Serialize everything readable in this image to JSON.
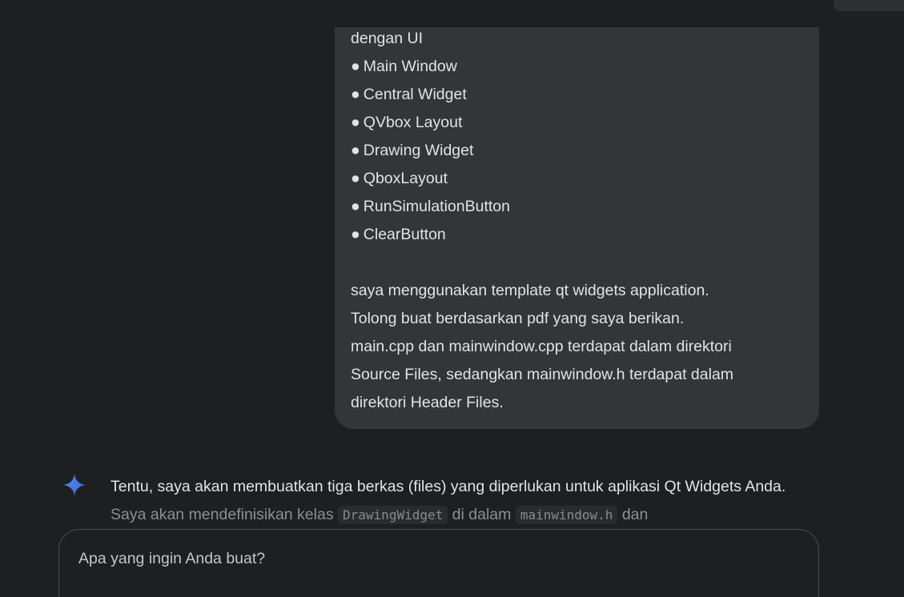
{
  "user_message": {
    "intro_fragment": "dengan UI",
    "bullet_symbol": "●",
    "components": [
      "Main Window",
      "Central Widget",
      "QVbox Layout",
      "Drawing Widget",
      "QboxLayout",
      "RunSimulationButton",
      "ClearButton"
    ],
    "paragraph_lines": [
      "saya menggunakan template qt widgets application.",
      "Tolong buat berdasarkan pdf yang saya berikan.",
      "main.cpp dan mainwindow.cpp terdapat dalam direktori",
      "Source Files, sedangkan mainwindow.h terdapat dalam",
      "direktori Header Files."
    ]
  },
  "model_response": {
    "icon": "gemini-sparkle-icon",
    "line1": "Tentu, saya akan membuatkan tiga berkas (files) yang diperlukan untuk aplikasi Qt Widgets Anda.",
    "line2_part1": "Saya akan mendefinisikan kelas",
    "line2_code1": "DrawingWidget",
    "line2_part2": "di dalam",
    "line2_code2": "mainwindow.h",
    "line2_part3": "dan"
  },
  "prompt_input": {
    "placeholder": "Apa yang ingin Anda buat?",
    "value": ""
  },
  "colors": {
    "background": "#1e1f20",
    "user_bubble": "#333537",
    "text_primary": "#e3e3e3",
    "text_faded": "#8e8f91",
    "sparkle_blue": "#4285f4"
  }
}
